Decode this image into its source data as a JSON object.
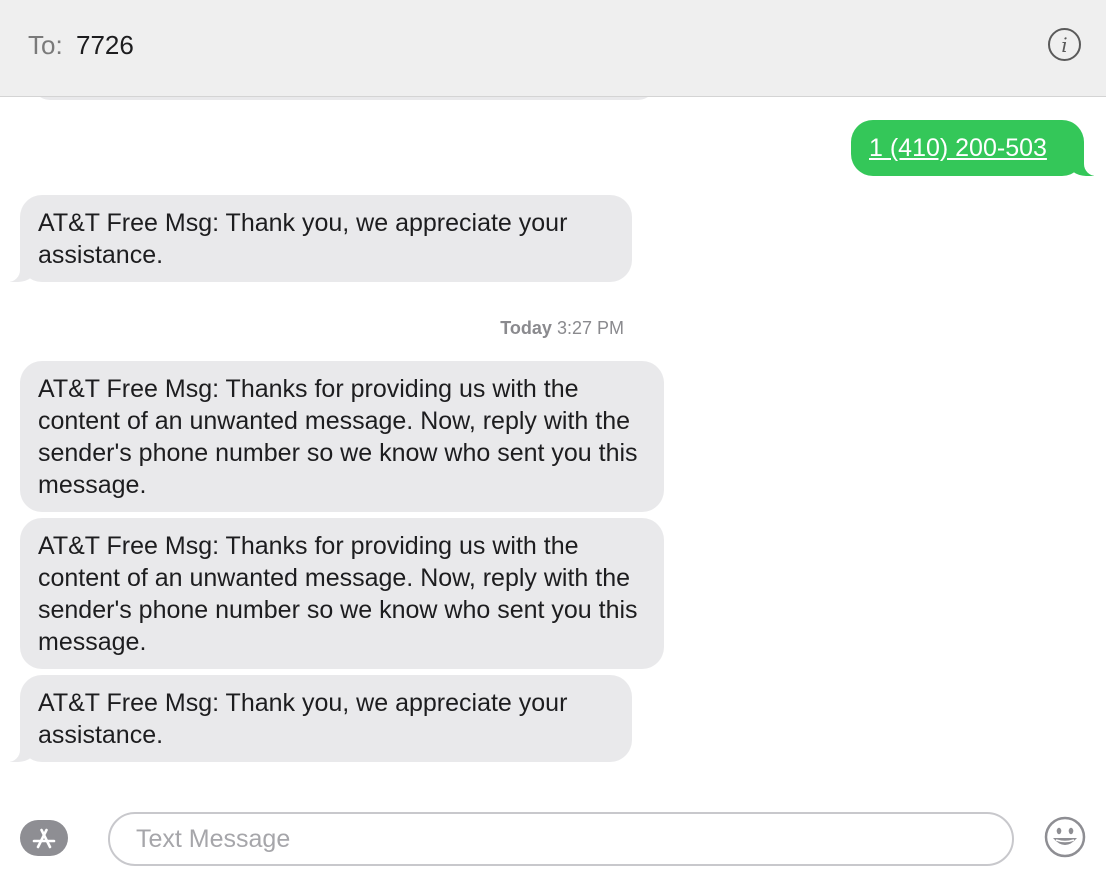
{
  "header": {
    "to_label": "To:",
    "recipient": "7726",
    "info_icon": "info-circle-icon"
  },
  "messages": [
    {
      "direction": "outgoing",
      "text": "1 (410) 200-503"
    },
    {
      "direction": "incoming",
      "text": "AT&T Free Msg: Thank you, we appreciate your assistance."
    },
    {
      "direction": "incoming",
      "text": "AT&T Free Msg: Thanks for providing us with the content of an unwanted message. Now, reply with the sender's phone number so we know who sent you this message."
    },
    {
      "direction": "incoming",
      "text": "AT&T Free Msg: Thanks for providing us with the content of an unwanted message. Now, reply with the sender's phone number so we know who sent you this message."
    },
    {
      "direction": "incoming",
      "text": "AT&T Free Msg: Thank you, we appreciate your assistance."
    }
  ],
  "timestamp": {
    "day": "Today",
    "time": "3:27 PM"
  },
  "composer": {
    "placeholder": "Text Message",
    "value": "",
    "apps_icon": "app-store-icon",
    "emoji_icon": "emoji-smile-icon"
  },
  "colors": {
    "incoming_bubble": "#e9e9eb",
    "outgoing_bubble": "#34c759",
    "header_bg": "#efefef"
  }
}
